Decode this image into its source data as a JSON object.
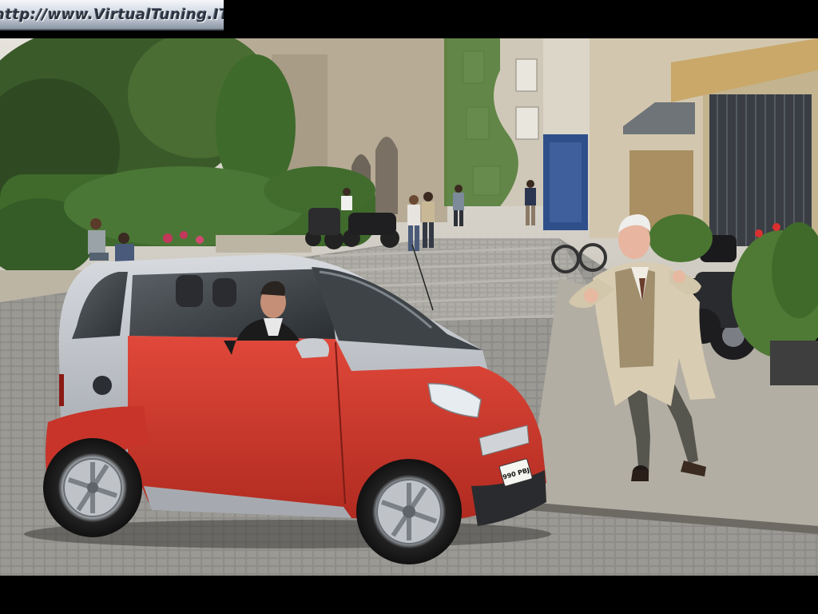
{
  "watermark": {
    "text": "http://www.VirtualTuning.IT"
  },
  "car": {
    "license_plate": "990 PBJ"
  },
  "colors": {
    "car_body": "#d2362a",
    "car_silver": "#b8bcc2",
    "trench_coat": "#d8cdb3",
    "cobblestone": "#8c8b88",
    "foliage": "#3e5a2c"
  }
}
